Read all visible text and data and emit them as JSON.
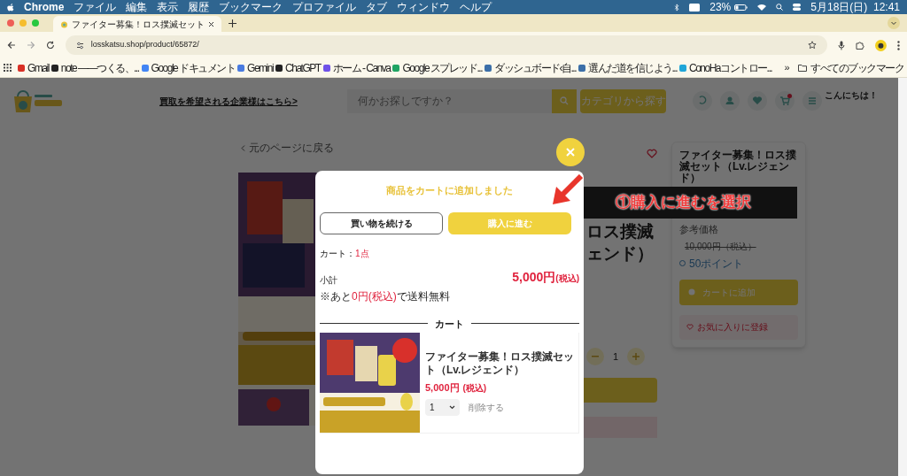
{
  "menu_bar": {
    "app": "Chrome",
    "menus": [
      "ファイル",
      "編集",
      "表示",
      "履歴",
      "ブックマーク",
      "プロファイル",
      "タブ",
      "ウィンドウ",
      "ヘルプ"
    ],
    "battery": "23%",
    "clock": "5月18日(日)  12:41"
  },
  "browser": {
    "tab_title": "ファイター募集！ロス撲滅セット",
    "url": "losskatsu.shop/product/65872/",
    "bookmarks": [
      {
        "label": "Gmail",
        "color": "#d93025"
      },
      {
        "label": "note ——つくる、...",
        "color": "#222222"
      },
      {
        "label": "Google ドキュメント",
        "color": "#4285f4"
      },
      {
        "label": "Gemini",
        "color": "#4a7be0"
      },
      {
        "label": "ChatGPT",
        "color": "#222222"
      },
      {
        "label": "ホーム - Canva",
        "color": "#6f52e8"
      },
      {
        "label": "Google スプレッド...",
        "color": "#1fa463"
      },
      {
        "label": "ダッシュボード‹自...",
        "color": "#3c6fa8"
      },
      {
        "label": "選んだ道を信じよう...",
        "color": "#3c6fa8"
      },
      {
        "label": "ConoHaコントロー...",
        "color": "#20a6d8"
      }
    ],
    "more_bookmarks": "»",
    "all_bookmarks": "すべてのブックマーク"
  },
  "site_header": {
    "business_link": "買取を希望される企業様はこちら>",
    "search_placeholder": "何かお探しですか？",
    "category_button": "カテゴリから探す",
    "greeting": "こんにちは！"
  },
  "product_page": {
    "back_link": "元のページに戻る",
    "title_lines": [
      "ロス撲滅",
      "ェンド）"
    ],
    "quantity": "1",
    "side_card": {
      "title": "ファイター募集！ロス撲滅セット（Lv.レジェンド）",
      "reference_label": "参考価格",
      "reference_price": "10,000円（税込）",
      "points": "50ポイント",
      "add_to_cart": "カートに追加",
      "favorite": "お気に入りに登録"
    }
  },
  "modal": {
    "heading": "商品をカートに追加しました",
    "continue_button": "買い物を続ける",
    "checkout_button": "購入に進む",
    "cart_label": "カート：",
    "cart_count": "1点",
    "subtotal_label": "小計",
    "subtotal": "5,000円",
    "subtotal_tax": "(税込)",
    "shipping_note": [
      "※あと",
      "0円(税込)",
      "で送料無料"
    ],
    "section_title": "カート",
    "item": {
      "name": "ファイター募集！ロス撲滅セット（Lv.レジェンド）",
      "price": "5,000円",
      "tax": "(税込)",
      "quantity": "1",
      "remove": "削除する"
    }
  },
  "annotation": {
    "text": "①購入に進むを選択"
  }
}
